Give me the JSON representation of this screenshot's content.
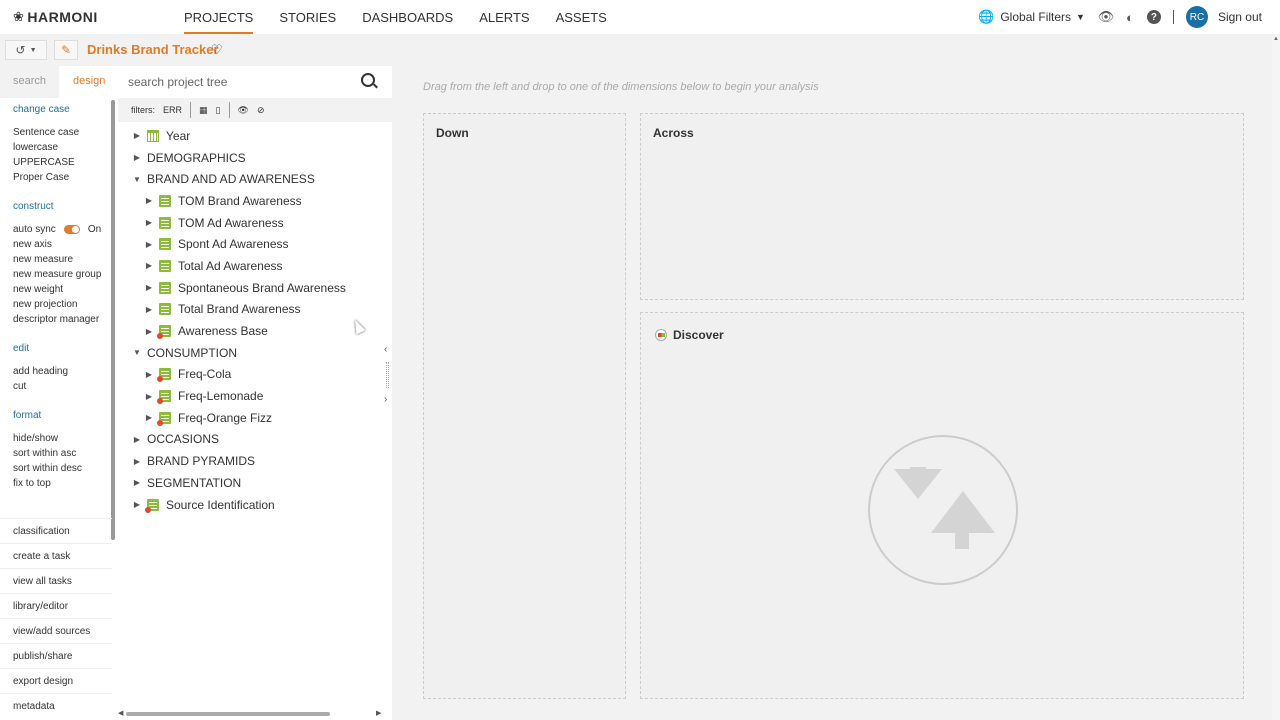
{
  "topbar": {
    "logo": "HARMONI",
    "nav": [
      "PROJECTS",
      "STORIES",
      "DASHBOARDS",
      "ALERTS",
      "ASSETS"
    ],
    "global_filters": "Global Filters",
    "avatar_initials": "RC",
    "sign_out": "Sign out"
  },
  "subbar": {
    "project_title": "Drinks Brand Tracker"
  },
  "leftmenu": {
    "tabs": [
      "search",
      "design"
    ],
    "change_case": {
      "heading": "change case",
      "items": [
        "Sentence case",
        "lowercase",
        "UPPERCASE",
        "Proper Case"
      ]
    },
    "construct": {
      "heading": "construct",
      "auto_sync": "auto sync",
      "auto_sync_state": "On",
      "items": [
        "new axis",
        "new measure",
        "new measure group",
        "new weight",
        "new projection",
        "descriptor manager"
      ]
    },
    "edit": {
      "heading": "edit",
      "items": [
        "add heading",
        "cut"
      ]
    },
    "format": {
      "heading": "format",
      "items": [
        "hide/show",
        "sort within asc",
        "sort within desc",
        "fix to top"
      ]
    },
    "bottom": [
      "classification",
      "create a task",
      "view all tasks",
      "library/editor",
      "view/add sources",
      "publish/share",
      "export design",
      "metadata"
    ]
  },
  "tree": {
    "search_placeholder": "search project tree",
    "filters_label": "filters:",
    "err_label": "ERR",
    "rows": [
      {
        "label": "Year",
        "level": 0,
        "caret": "right",
        "icon": "calendar-icon"
      },
      {
        "label": "DEMOGRAPHICS",
        "level": 0,
        "caret": "right",
        "icon": ""
      },
      {
        "label": "BRAND AND AD AWARENESS",
        "level": 0,
        "caret": "down",
        "icon": ""
      },
      {
        "label": "TOM Brand Awareness",
        "level": 1,
        "caret": "right",
        "icon": "measure-icon"
      },
      {
        "label": "TOM Ad Awareness",
        "level": 1,
        "caret": "right",
        "icon": "measure-icon"
      },
      {
        "label": "Spont Ad Awareness",
        "level": 1,
        "caret": "right",
        "icon": "measure-icon"
      },
      {
        "label": "Total Ad Awareness",
        "level": 1,
        "caret": "right",
        "icon": "measure-icon"
      },
      {
        "label": "Spontaneous Brand Awareness",
        "level": 1,
        "caret": "right",
        "icon": "measure-icon"
      },
      {
        "label": "Total Brand Awareness",
        "level": 1,
        "caret": "right",
        "icon": "measure-icon"
      },
      {
        "label": "Awareness Base",
        "level": 1,
        "caret": "right",
        "icon": "measure-base-icon"
      },
      {
        "label": "CONSUMPTION",
        "level": 0,
        "caret": "down",
        "icon": ""
      },
      {
        "label": "Freq-Cola",
        "level": 1,
        "caret": "right",
        "icon": "measure-base-icon"
      },
      {
        "label": "Freq-Lemonade",
        "level": 1,
        "caret": "right",
        "icon": "measure-base-icon"
      },
      {
        "label": "Freq-Orange Fizz",
        "level": 1,
        "caret": "right",
        "icon": "measure-base-icon"
      },
      {
        "label": "OCCASIONS",
        "level": 0,
        "caret": "right",
        "icon": ""
      },
      {
        "label": "BRAND PYRAMIDS",
        "level": 0,
        "caret": "right",
        "icon": ""
      },
      {
        "label": "SEGMENTATION",
        "level": 0,
        "caret": "right",
        "icon": ""
      },
      {
        "label": "Source Identification",
        "level": 0,
        "caret": "right",
        "icon": "measure-base-icon"
      }
    ]
  },
  "canvas": {
    "hint": "Drag from the left and drop to one of the dimensions below to begin your analysis",
    "down_label": "Down",
    "across_label": "Across",
    "discover_label": "Discover"
  },
  "colors": {
    "accent": "#e07b2a",
    "link": "#1b6fa8",
    "measure": "#8dbb3a"
  }
}
